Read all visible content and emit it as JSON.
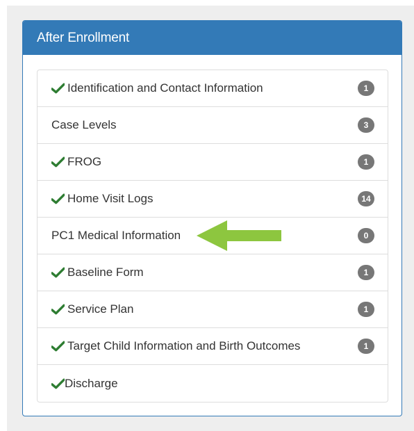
{
  "panel": {
    "title": "After Enrollment"
  },
  "items": [
    {
      "label": "Identification and Contact Information",
      "badge": "1",
      "checked": true
    },
    {
      "label": "Case Levels",
      "badge": "3",
      "checked": false
    },
    {
      "label": "FROG",
      "badge": "1",
      "checked": true
    },
    {
      "label": "Home Visit Logs",
      "badge": "14",
      "checked": true
    },
    {
      "label": "PC1 Medical Information",
      "badge": "0",
      "checked": false
    },
    {
      "label": "Baseline Form",
      "badge": "1",
      "checked": true
    },
    {
      "label": "Service Plan",
      "badge": "1",
      "checked": true
    },
    {
      "label": "Target Child Information and Birth Outcomes",
      "badge": "1",
      "checked": true
    },
    {
      "label": "Discharge",
      "badge": "",
      "checked": true
    }
  ],
  "icons": {
    "check": "checkmark-icon",
    "arrow": "left-arrow-icon"
  },
  "colors": {
    "accent": "#337ab7",
    "check": "#2e7d32",
    "badge": "#777777",
    "arrow": "#8dc63f"
  }
}
